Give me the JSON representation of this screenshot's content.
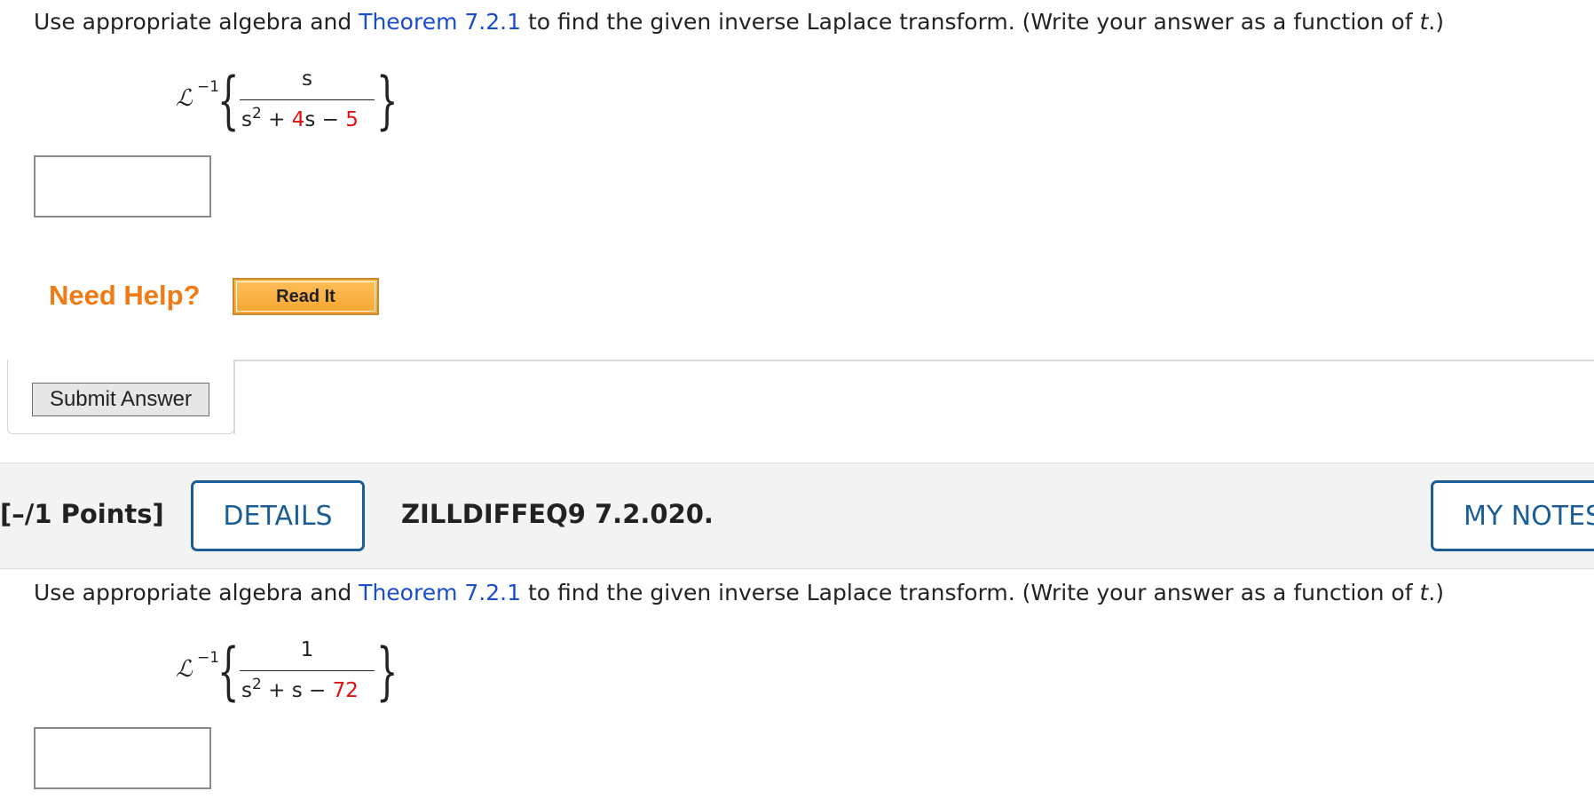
{
  "question1": {
    "prompt_before_link": "Use appropriate algebra and ",
    "theorem_link": "Theorem 7.2.1",
    "prompt_after_link": " to find the given inverse Laplace transform. (Write your answer as a function of ",
    "prompt_var": "t",
    "prompt_end": ".)",
    "laplace_symbol": "ℒ",
    "laplace_exponent": "−1",
    "numerator": "s",
    "den_s": "s",
    "den_pow": "2",
    "den_op1": " + ",
    "den_coef": "4",
    "den_term2": "s",
    "den_op2": " − ",
    "den_const": "5",
    "answer_value": ""
  },
  "help": {
    "need_help_label": "Need Help?",
    "read_it_label": "Read It"
  },
  "submit": {
    "label": "Submit Answer"
  },
  "question2_header": {
    "points": "[–/1 Points]",
    "details_label": "DETAILS",
    "question_id": "ZILLDIFFEQ9 7.2.020.",
    "my_notes_label": "MY NOTES"
  },
  "question2": {
    "prompt_before_link": "Use appropriate algebra and ",
    "theorem_link": "Theorem 7.2.1",
    "prompt_after_link": " to find the given inverse Laplace transform. (Write your answer as a function of ",
    "prompt_var": "t",
    "prompt_end": ".)",
    "laplace_symbol": "ℒ",
    "laplace_exponent": "−1",
    "numerator": "1",
    "den_s": "s",
    "den_pow": "2",
    "den_op1": " + ",
    "den_term2": "s",
    "den_op2": " − ",
    "den_const": "72",
    "answer_value": ""
  },
  "colors": {
    "link": "#1a4dcc",
    "randomized_number": "#e01010",
    "need_help": "#f07a14",
    "header_button": "#1b5e97"
  }
}
